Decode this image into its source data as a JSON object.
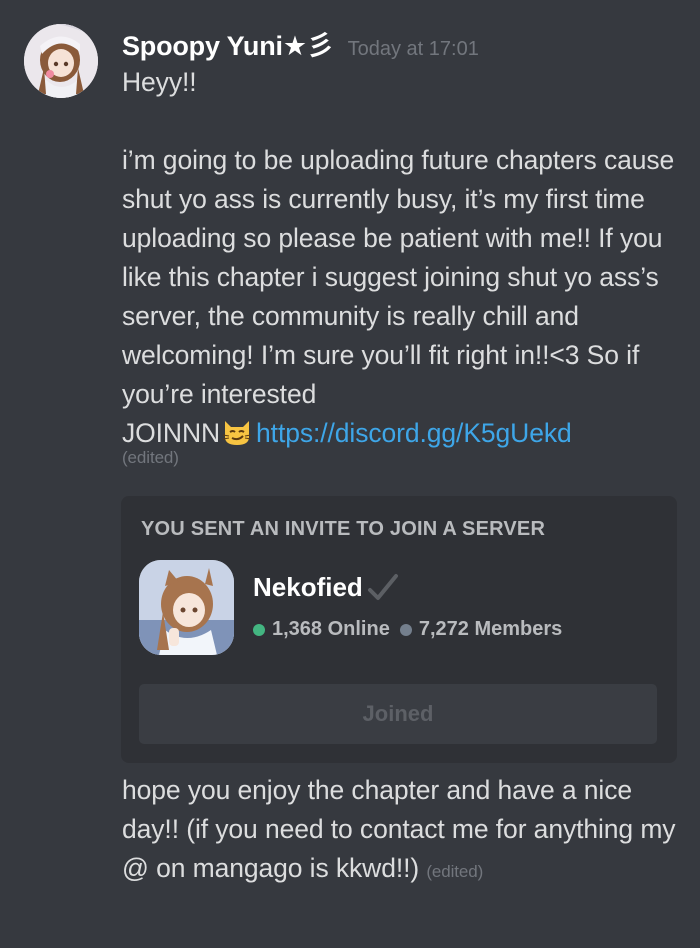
{
  "message": {
    "author": "Spoopy Yuni★彡",
    "timestamp": "Today at 17:01",
    "greeting": "Heyy!!",
    "body": "i’m going to be uploading future chapters cause shut yo ass is currently busy, it’s my first time uploading so please be patient with me!! If you like this chapter i suggest joining shut yo ass’s server, the community is really chill and welcoming! I’m sure you’ll fit right in!!<3 So if you’re interested",
    "join_text": "JOINNN",
    "emoji": "smirk-cat-emoji",
    "link": "https://discord.gg/K5gUekd",
    "edited_label": "(edited)",
    "closing": "hope you enjoy the chapter and have a nice day!! (if you need to contact me for anything my @ on mangago is kkwd!!)",
    "closing_edited_label": "(edited)"
  },
  "invite": {
    "title": "YOU SENT AN INVITE TO JOIN A SERVER",
    "server_name": "Nekofied",
    "online": "1,368 Online",
    "members": "7,272 Members",
    "button_label": "Joined"
  },
  "colors": {
    "background": "#36393f",
    "embed_background": "#2f3136",
    "link": "#3ea6e8",
    "online": "#43b581",
    "muted": "#72767d"
  }
}
